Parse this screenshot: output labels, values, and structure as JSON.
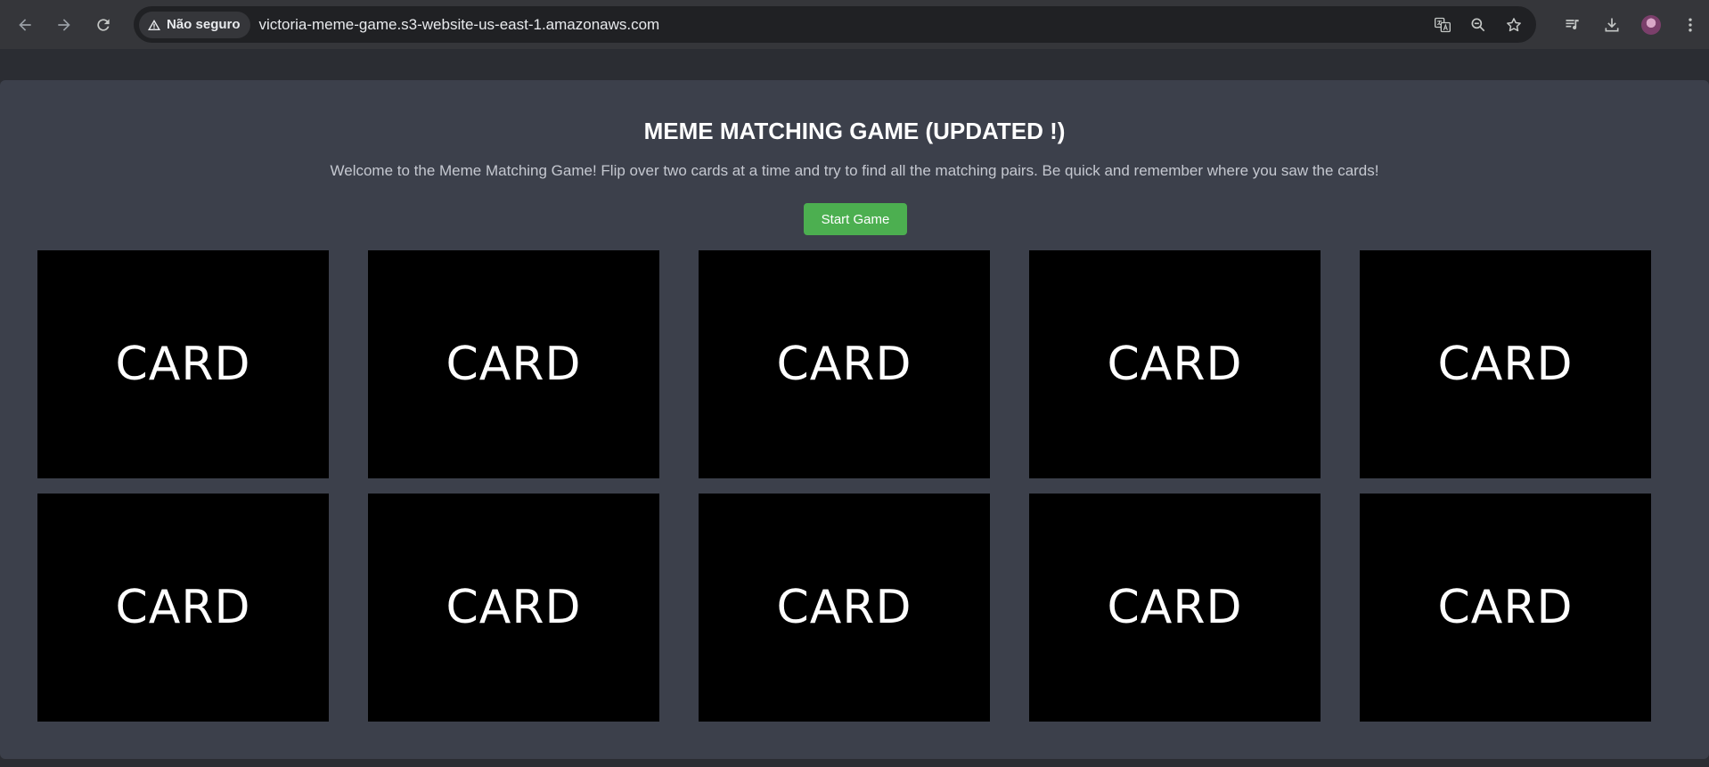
{
  "browser": {
    "security_label": "Não seguro",
    "url": "victoria-meme-game.s3-website-us-east-1.amazonaws.com",
    "icons": [
      "back-arrow-icon",
      "forward-arrow-icon",
      "reload-icon",
      "warning-icon",
      "translate-icon",
      "zoom-out-icon",
      "star-icon",
      "media-queue-icon",
      "download-icon",
      "profile-avatar",
      "more-vert-icon"
    ]
  },
  "game": {
    "title": "MEME MATCHING GAME (UPDATED !)",
    "description": "Welcome to the Meme Matching Game! Flip over two cards at a time and try to find all the matching pairs. Be quick and remember where you saw the cards!",
    "start_label": "Start Game",
    "button_color": "#4caf50",
    "cards": [
      {
        "label": "CARD"
      },
      {
        "label": "CARD"
      },
      {
        "label": "CARD"
      },
      {
        "label": "CARD"
      },
      {
        "label": "CARD"
      },
      {
        "label": "CARD"
      },
      {
        "label": "CARD"
      },
      {
        "label": "CARD"
      },
      {
        "label": "CARD"
      },
      {
        "label": "CARD"
      }
    ]
  }
}
